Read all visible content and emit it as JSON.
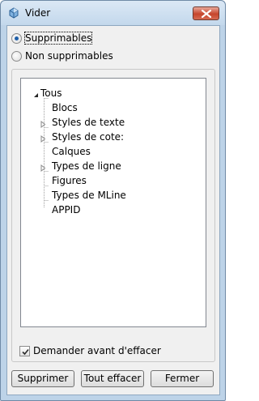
{
  "window": {
    "title": "Vider",
    "icon": "purge-app-icon",
    "close_icon": "close-icon"
  },
  "options": {
    "selected": "Supprimables",
    "items": [
      {
        "label": "Supprimables",
        "checked": true
      },
      {
        "label": "Non supprimables",
        "checked": false
      }
    ]
  },
  "tree": {
    "root": {
      "label": "Tous",
      "expanded": true
    },
    "children": [
      {
        "label": "Blocs",
        "has_children": false
      },
      {
        "label": "Styles de texte",
        "has_children": true
      },
      {
        "label": "Styles de cote:",
        "has_children": true
      },
      {
        "label": "Calques",
        "has_children": false
      },
      {
        "label": "Types de ligne",
        "has_children": true
      },
      {
        "label": "Figures",
        "has_children": false
      },
      {
        "label": "Types de MLine",
        "has_children": false
      },
      {
        "label": "APPID",
        "has_children": false
      }
    ]
  },
  "confirm": {
    "label": "Demander avant d'effacer",
    "checked": true
  },
  "buttons": {
    "purge": "Supprimer",
    "purge_all": "Tout effacer",
    "close": "Fermer"
  }
}
